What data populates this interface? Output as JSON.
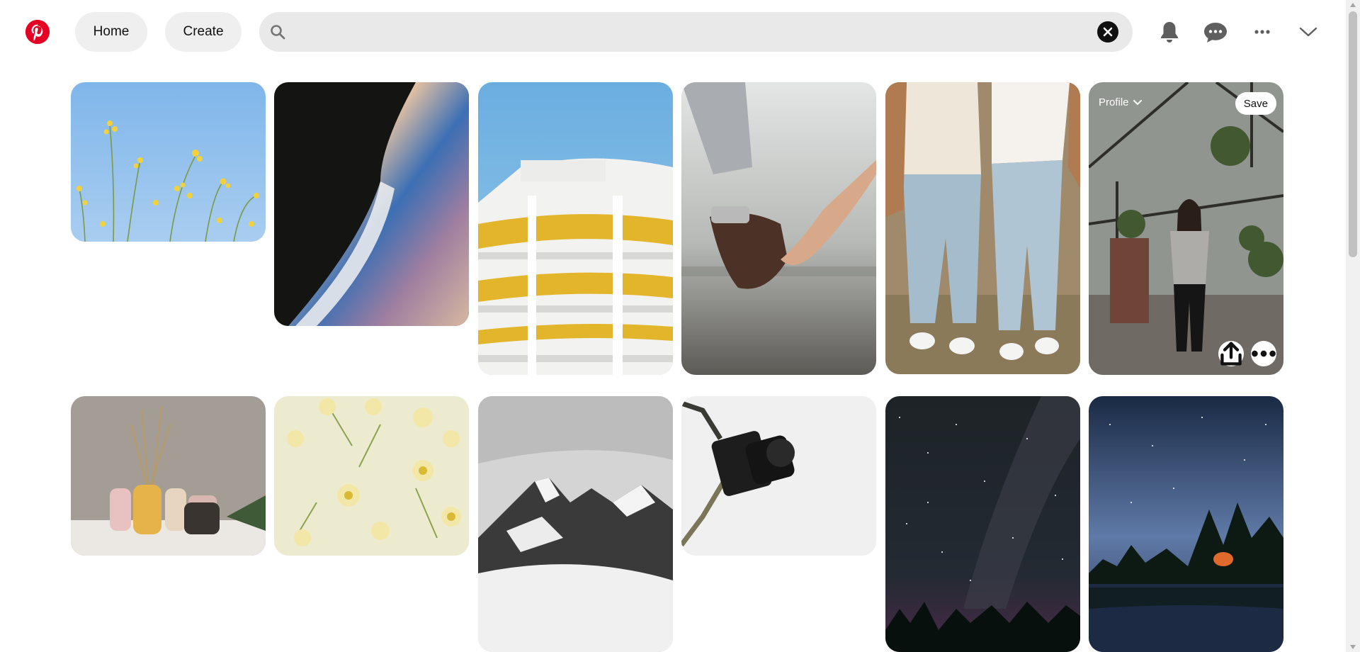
{
  "header": {
    "logo_icon": "pinterest-logo",
    "nav": [
      {
        "label": "Home"
      },
      {
        "label": "Create"
      }
    ],
    "search": {
      "placeholder": "",
      "value": "",
      "icon": "search-icon",
      "clear_icon": "close-icon"
    },
    "actions": [
      "bell-icon",
      "chat-bubble-icon",
      "more-dots-icon",
      "chevron-down-icon"
    ]
  },
  "pins": [
    {
      "id": "yellow-flowers-sky",
      "theme": "yellow wildflowers against blue sky"
    },
    {
      "id": "abstract-iridescent",
      "theme": "abstract dark iridescent curve"
    },
    {
      "id": "white-building",
      "theme": "white round building with yellow ceilings"
    },
    {
      "id": "holding-hands-beach",
      "theme": "holding hands at the sea"
    },
    {
      "id": "couple-walking",
      "theme": "couple in jeans holding hands"
    },
    {
      "id": "greenhouse-woman",
      "theme": "woman posing in greenhouse",
      "overlay": {
        "profile_label": "Profile",
        "save_label": "Save",
        "share_icon": "share-icon",
        "more_icon": "more-dots-icon"
      }
    },
    {
      "id": "vases-dried-grass",
      "theme": "vases with dried grass"
    },
    {
      "id": "yellow-flowers-water",
      "theme": "yellow flowers floating on water"
    },
    {
      "id": "snowy-mountains",
      "theme": "black and white snowy mountains"
    },
    {
      "id": "camera-strap",
      "theme": "camera with strap on white"
    },
    {
      "id": "milky-way-aurora",
      "theme": "milky way night sky over trees"
    },
    {
      "id": "starry-lake-camp",
      "theme": "star trails over lake with campfire"
    }
  ],
  "colors": {
    "brand": "#e60023",
    "pill_bg": "#efefef",
    "search_bg": "#e9e9e9"
  }
}
